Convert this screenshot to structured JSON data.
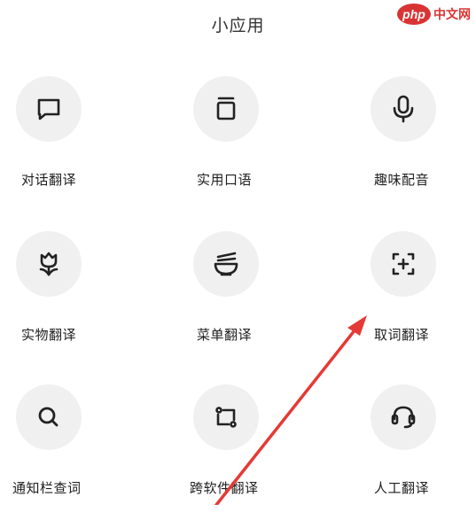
{
  "header": {
    "title": "小应用"
  },
  "watermark": {
    "logo_text": "php",
    "site_text": "中文网"
  },
  "apps": [
    {
      "label": "对话翻译",
      "icon": "chat-bubble-icon"
    },
    {
      "label": "实用口语",
      "icon": "clipboard-icon"
    },
    {
      "label": "趣味配音",
      "icon": "microphone-icon"
    },
    {
      "label": "实物翻译",
      "icon": "tulip-icon"
    },
    {
      "label": "菜单翻译",
      "icon": "noodle-bowl-icon"
    },
    {
      "label": "取词翻译",
      "icon": "scan-plus-icon"
    },
    {
      "label": "通知栏查词",
      "icon": "search-icon"
    },
    {
      "label": "跨软件翻译",
      "icon": "cross-app-icon"
    },
    {
      "label": "人工翻译",
      "icon": "headset-icon"
    }
  ],
  "annotation": {
    "arrow_color": "#e53935"
  }
}
